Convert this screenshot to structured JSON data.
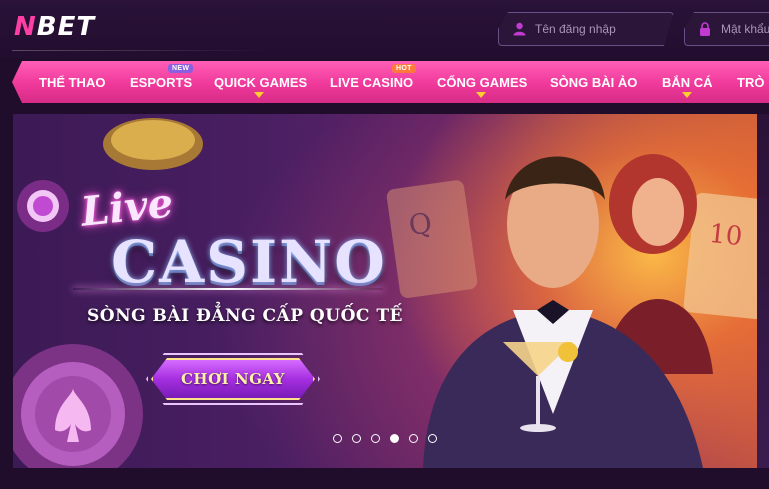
{
  "brand": {
    "logo_prefix": "N",
    "logo_suffix": "BET"
  },
  "login": {
    "username_placeholder": "Tên đăng nhập",
    "password_placeholder": "Mật khẩu"
  },
  "nav": {
    "items": [
      {
        "label": "THỂ THAO"
      },
      {
        "label": "ESPORTS",
        "badge": "NEW"
      },
      {
        "label": "QUICK GAMES"
      },
      {
        "label": "LIVE CASINO",
        "badge": "HOT"
      },
      {
        "label": "CỔNG GAMES"
      },
      {
        "label": "SÒNG BÀI ẢO"
      },
      {
        "label": "BẮN CÁ"
      },
      {
        "label": "TRÒ"
      }
    ]
  },
  "banner": {
    "live_text": "Live",
    "title": "CASINO",
    "tagline": "SÒNG BÀI ĐẲNG CẤP QUỐC TẾ",
    "cta_label": "CHƠI NGAY",
    "card_rank_q": "Q",
    "card_rank_10": "10",
    "slides_total": 6,
    "active_slide": 4
  },
  "colors": {
    "accent_pink": "#f0399b",
    "nav_caret": "#ffcf2e",
    "badge_new": "#8a5fe0",
    "badge_hot": "#ff7a3d"
  }
}
